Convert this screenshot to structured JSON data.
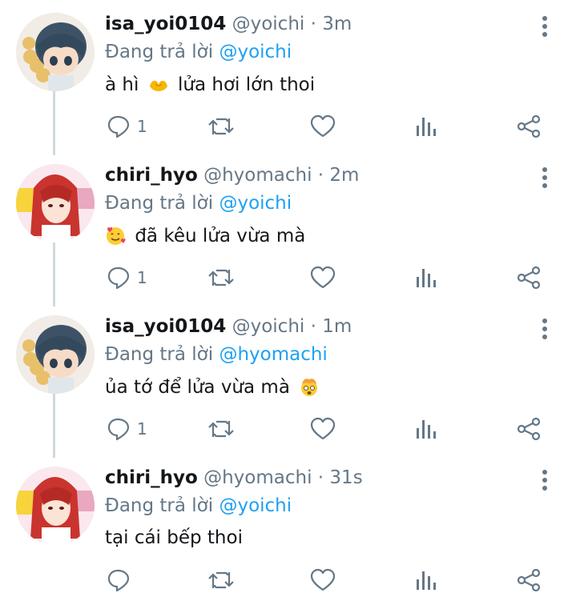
{
  "tweets": [
    {
      "name": "isa_yoi0104",
      "handle": "@yoichi",
      "separator": "·",
      "time": "3m",
      "reply_prefix": "Đang trả lời",
      "reply_to": "@yoichi",
      "text_before": "à hì",
      "emoji": "heart-hands-emoji",
      "text_after": "lửa hơi lớn thoi",
      "reply_count": "1",
      "avatar": "blue-hair-figure-avatar"
    },
    {
      "name": "chiri_hyo",
      "handle": "@hyomachi",
      "separator": "·",
      "time": "2m",
      "reply_prefix": "Đang trả lời",
      "reply_to": "@yoichi",
      "text_before": "",
      "emoji": "smiling-face-with-hearts-emoji",
      "text_after": "đã kêu lửa vừa mà",
      "reply_count": "1",
      "avatar": "red-hair-anime-avatar"
    },
    {
      "name": "isa_yoi0104",
      "handle": "@yoichi",
      "separator": "·",
      "time": "1m",
      "reply_prefix": "Đang trả lời",
      "reply_to": "@hyomachi",
      "text_before": "ủa tớ để lửa vừa mà",
      "emoji": "exploding-head-emoji",
      "text_after": "",
      "reply_count": "1",
      "avatar": "blue-hair-figure-avatar"
    },
    {
      "name": "chiri_hyo",
      "handle": "@hyomachi",
      "separator": "·",
      "time": "31s",
      "reply_prefix": "Đang trả lời",
      "reply_to": "@yoichi",
      "text_before": "tại cái bếp thoi",
      "emoji": "",
      "text_after": "",
      "reply_count": "",
      "avatar": "red-hair-anime-avatar"
    }
  ],
  "colors": {
    "text": "#14171a",
    "secondary": "#657786",
    "mention": "#1da1f2",
    "thread_line": "#cfd9de"
  }
}
